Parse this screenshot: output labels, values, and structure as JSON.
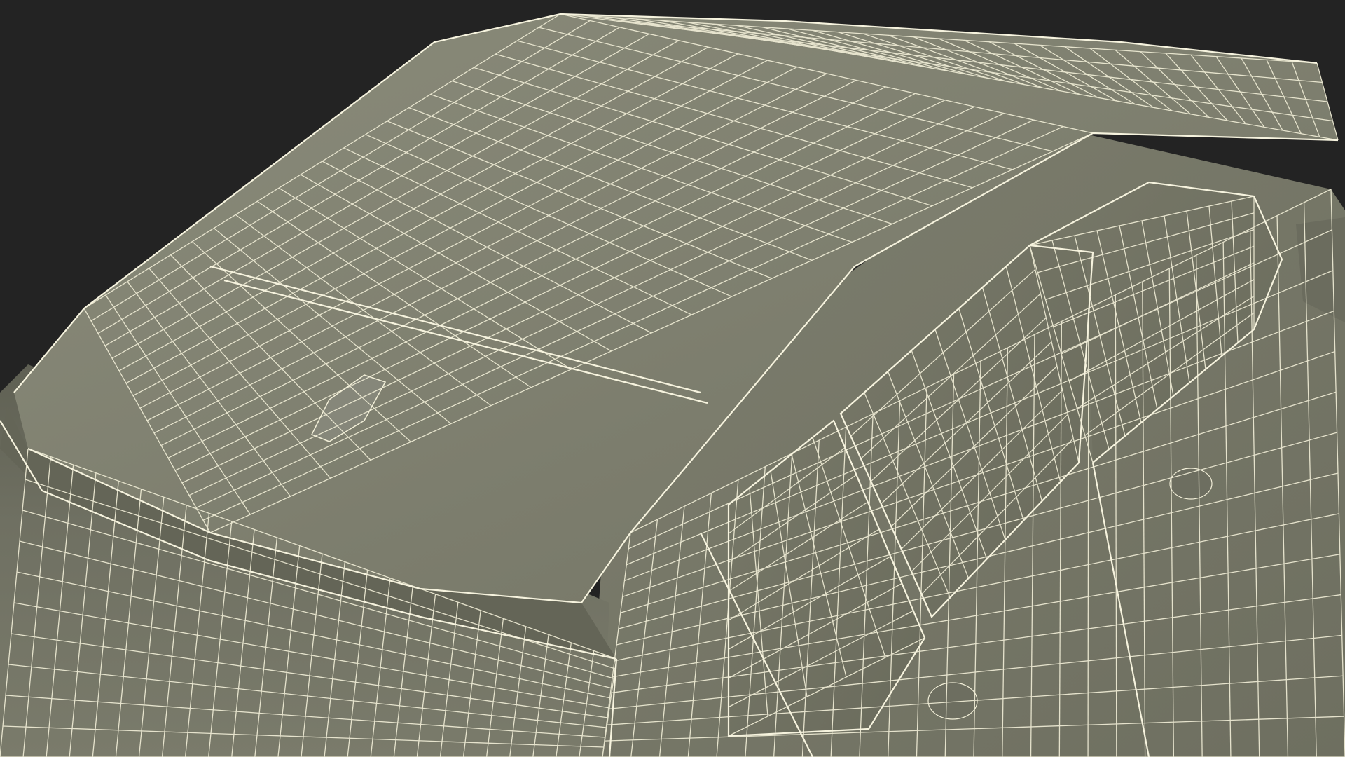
{
  "scene": {
    "subject": "car-wireframe-render",
    "colors": {
      "background": "#232323",
      "surface_light": "#8a8b7a",
      "surface_mid": "#7b7c6c",
      "surface_dark": "#5e5f52",
      "wire": "#f2efd8"
    }
  }
}
